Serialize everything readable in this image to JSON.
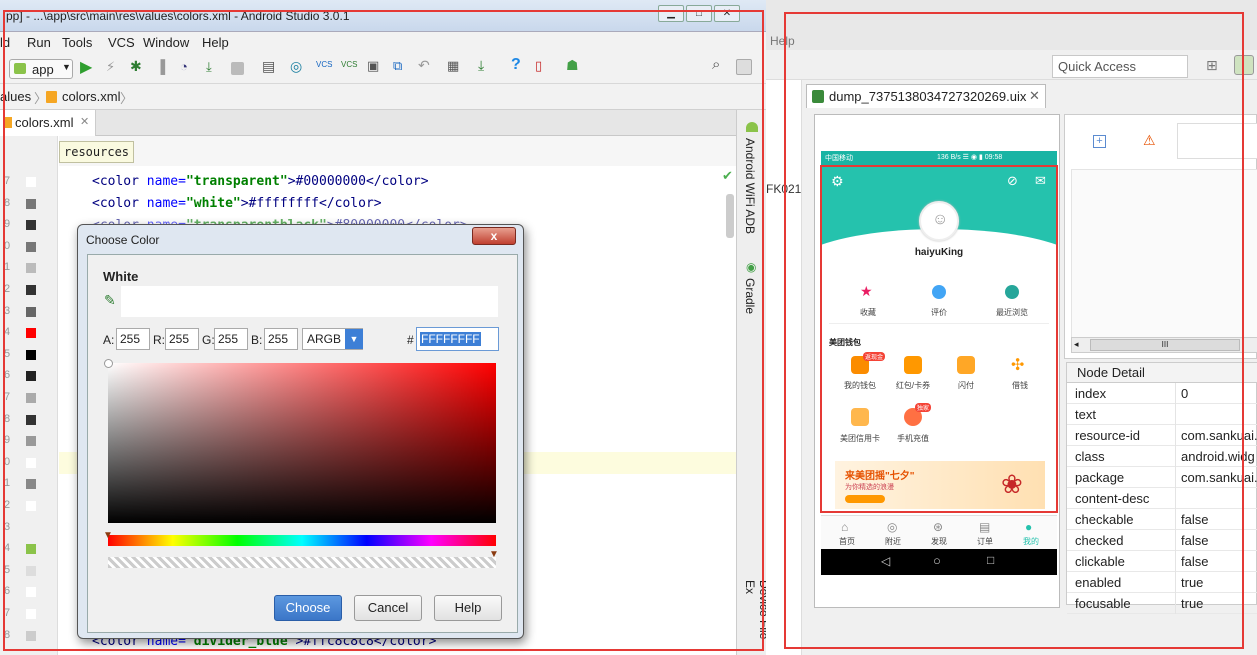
{
  "as": {
    "title": "pp] - ...\\app\\src\\main\\res\\values\\colors.xml - Android Studio 3.0.1",
    "menu": [
      "ld",
      "Run",
      "Tools",
      "VCS",
      "Window",
      "Help"
    ],
    "run_config": "app",
    "breadcrumb": [
      "alues",
      "colors.xml"
    ],
    "tab_label": "colors.xml",
    "tag_hint": "resources",
    "right_tools": [
      "Android WiFi ADB",
      "Gradle",
      "Device File Ex"
    ],
    "line_numbers": [
      "7",
      "8",
      "9",
      "0",
      "1",
      "2",
      "3",
      "4",
      "5",
      "6",
      "7",
      "8",
      "9",
      "0",
      "1",
      "2",
      "3",
      "4",
      "5",
      "6",
      "7",
      "8"
    ],
    "swatch_colors": [
      "#ffffff",
      "#777777",
      "#333333",
      "#777777",
      "#bbbbbb",
      "#333333",
      "#666666",
      "#ff0000",
      "#000000",
      "#222222",
      "#aaaaaa",
      "#333333",
      "#999999",
      "#ffffff",
      "#888888",
      "#ffffff",
      "#f0f0f0",
      "#8bc34a",
      "#dddddd",
      "#ffffff",
      "#ffffff",
      "#cccccc"
    ],
    "code": {
      "l1": {
        "open": "<color ",
        "attr": "name=",
        "val": "\"transparent\"",
        "rest": ">#00000000</color>"
      },
      "l2": {
        "open": "<color ",
        "attr": "name=",
        "val": "\"white\"",
        "rest": ">#ffffffff</color>"
      },
      "l3": {
        "open": "<color ",
        "attr": "name=",
        "val": "\"transparentblack\"",
        "rest": ">#80000000</color>"
      },
      "last": {
        "open": "<color ",
        "attr": "name=",
        "val": "\"divider_blue\"",
        "rest": ">#ffc8c8c8</color>"
      }
    }
  },
  "dialog": {
    "title": "Choose Color",
    "color_name": "White",
    "a_label": "A:",
    "a_value": "255",
    "r_label": "R:",
    "r_value": "255",
    "g_label": "G:",
    "g_value": "255",
    "b_label": "B:",
    "b_value": "255",
    "mode": "ARGB",
    "hash": "#",
    "hex_value": "FFFFFFFF",
    "choose": "Choose",
    "cancel": "Cancel",
    "help": "Help",
    "close": "x"
  },
  "eclipse": {
    "menu_help": "Help",
    "quick_access": "Quick Access",
    "dump_tab": "dump_7375138034727320269.uix",
    "side_text": "FK021",
    "node_detail_title": "Node Detail",
    "scroll_mark": "III",
    "details": [
      {
        "k": "index",
        "v": "0"
      },
      {
        "k": "text",
        "v": ""
      },
      {
        "k": "resource-id",
        "v": "com.sankuai."
      },
      {
        "k": "class",
        "v": "android.widg"
      },
      {
        "k": "package",
        "v": "com.sankuai."
      },
      {
        "k": "content-desc",
        "v": ""
      },
      {
        "k": "checkable",
        "v": "false"
      },
      {
        "k": "checked",
        "v": "false"
      },
      {
        "k": "clickable",
        "v": "false"
      },
      {
        "k": "enabled",
        "v": "true"
      },
      {
        "k": "focusable",
        "v": "true"
      }
    ]
  },
  "phone": {
    "status_left": "中国移动",
    "status_right": "136 B/s ☰ ◉ ▮ 09:58",
    "username": "haiyuKing",
    "quick": [
      "收藏",
      "评价",
      "最近浏览"
    ],
    "wallet_title": "美团钱包",
    "wallet_items": [
      "我的钱包",
      "红包/卡券",
      "闪付",
      "借钱",
      "美团信用卡",
      "手机充值"
    ],
    "badge1": "返现金",
    "badge2": "独家",
    "banner_main": "来美团摇\"七夕\"",
    "banner_sub": "为你精选的浪漫",
    "nav": [
      "首页",
      "附近",
      "发现",
      "订单",
      "我的"
    ],
    "sysnav": [
      "◁",
      "○",
      "□"
    ],
    "accent": "#25c2ad"
  }
}
